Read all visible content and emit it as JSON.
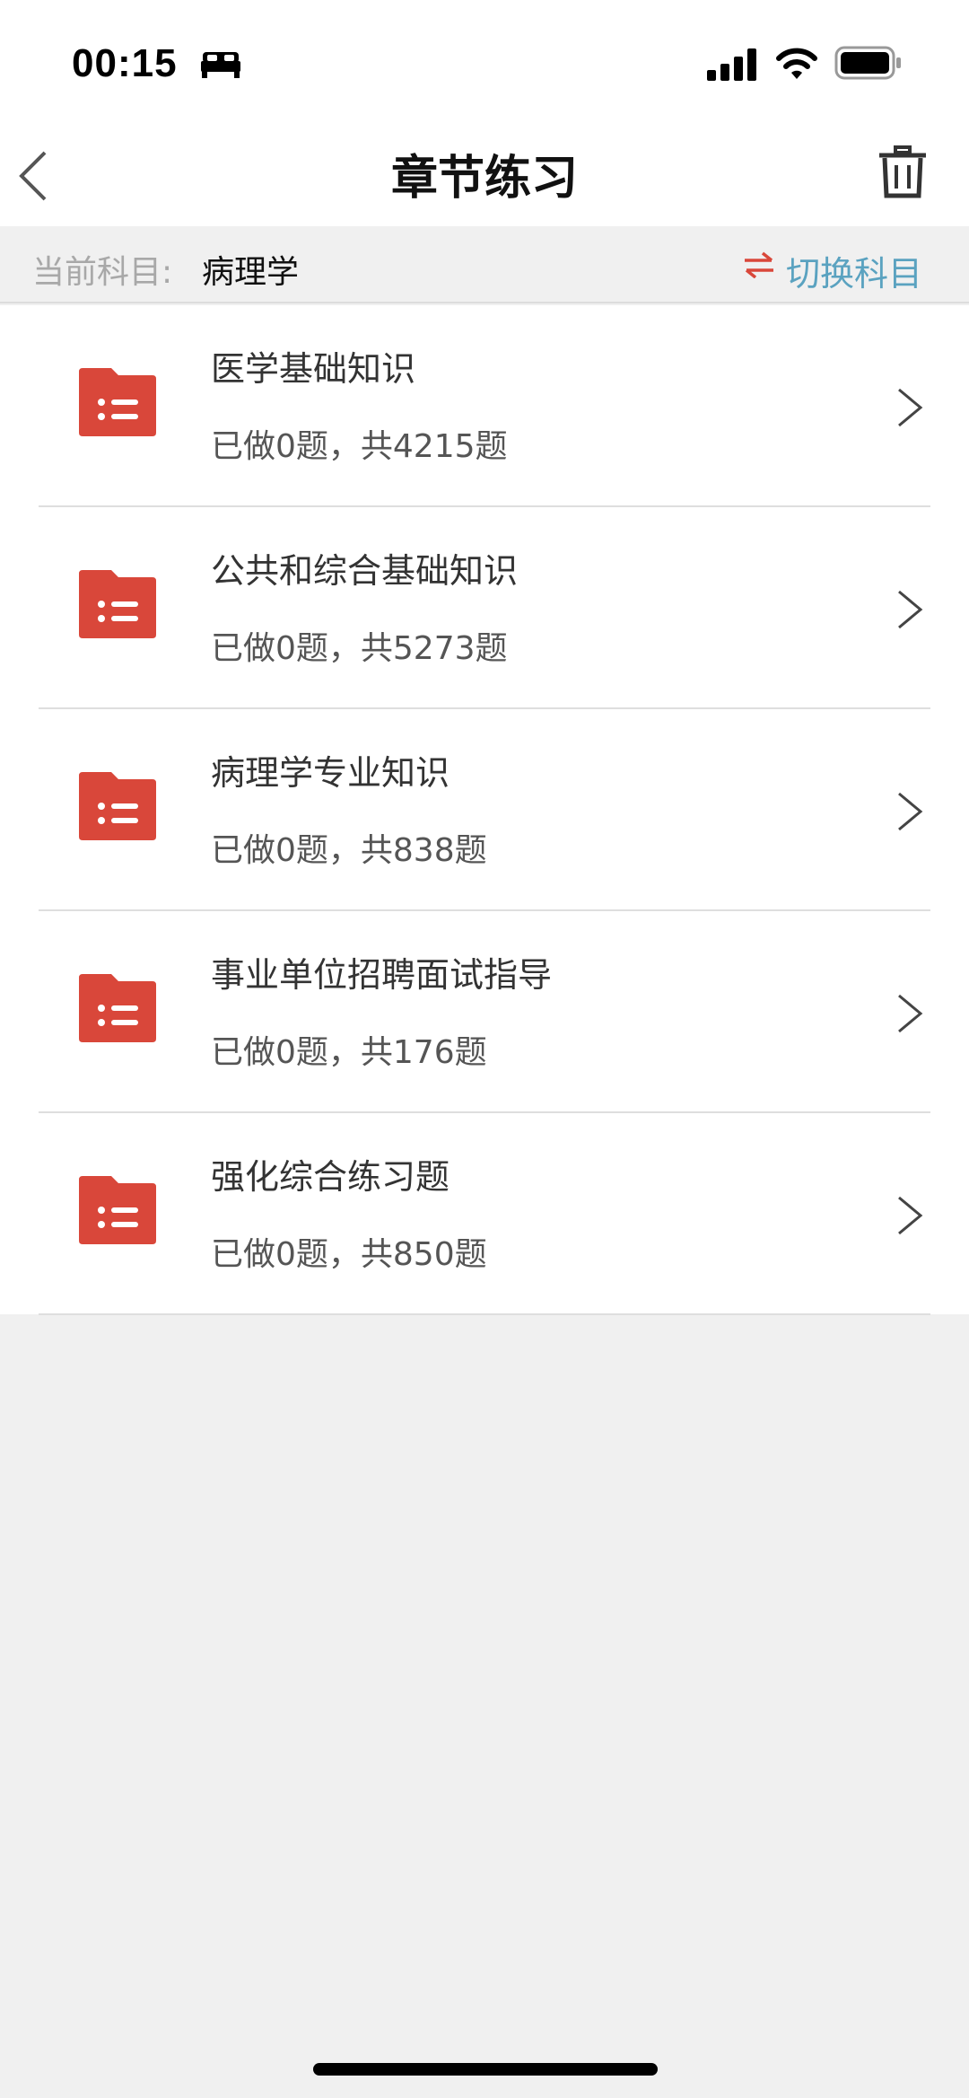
{
  "status_bar": {
    "time": "00:15"
  },
  "nav": {
    "title": "章节练习"
  },
  "subject": {
    "label": "当前科目:",
    "value": "病理学",
    "switch_label": "切换科目"
  },
  "colors": {
    "accent_red": "#d9473a",
    "switch_blue": "#5aa2c0"
  },
  "chapters": [
    {
      "title": "医学基础知识",
      "progress": "已做0题，共4215题"
    },
    {
      "title": "公共和综合基础知识",
      "progress": "已做0题，共5273题"
    },
    {
      "title": "病理学专业知识",
      "progress": "已做0题，共838题"
    },
    {
      "title": "事业单位招聘面试指导",
      "progress": "已做0题，共176题"
    },
    {
      "title": "强化综合练习题",
      "progress": "已做0题，共850题"
    }
  ]
}
